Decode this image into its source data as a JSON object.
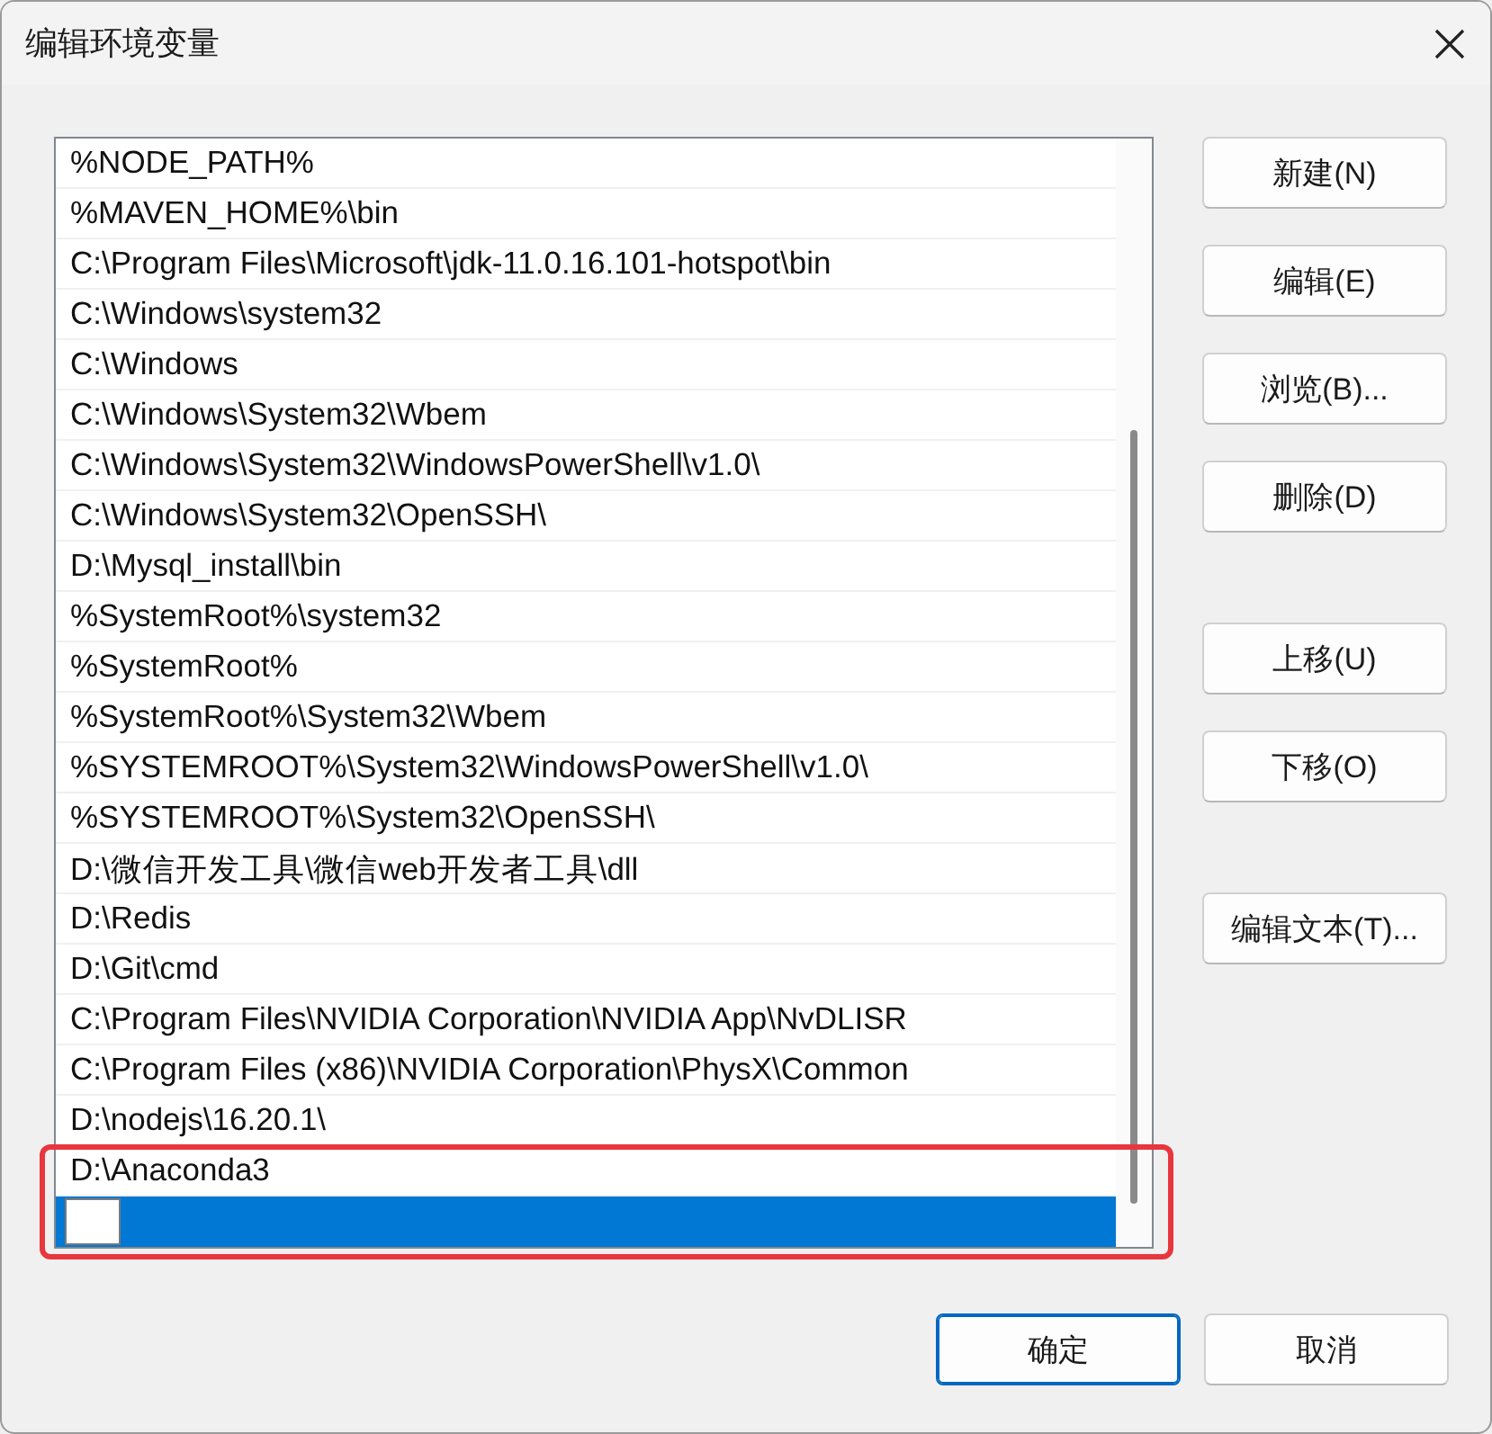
{
  "window": {
    "title": "编辑环境变量"
  },
  "paths": [
    {
      "kind": "text",
      "text": "%NODE_PATH%",
      "selected": false
    },
    {
      "kind": "text",
      "text": "%MAVEN_HOME%\\bin",
      "selected": false
    },
    {
      "kind": "text",
      "text": "C:\\Program Files\\Microsoft\\jdk-11.0.16.101-hotspot\\bin",
      "selected": false
    },
    {
      "kind": "text",
      "text": "C:\\Windows\\system32",
      "selected": false
    },
    {
      "kind": "text",
      "text": "C:\\Windows",
      "selected": false
    },
    {
      "kind": "text",
      "text": "C:\\Windows\\System32\\Wbem",
      "selected": false
    },
    {
      "kind": "text",
      "text": "C:\\Windows\\System32\\WindowsPowerShell\\v1.0\\",
      "selected": false
    },
    {
      "kind": "text",
      "text": "C:\\Windows\\System32\\OpenSSH\\",
      "selected": false
    },
    {
      "kind": "text",
      "text": "D:\\Mysql_install\\bin",
      "selected": false
    },
    {
      "kind": "text",
      "text": "%SystemRoot%\\system32",
      "selected": false
    },
    {
      "kind": "text",
      "text": "%SystemRoot%",
      "selected": false
    },
    {
      "kind": "text",
      "text": "%SystemRoot%\\System32\\Wbem",
      "selected": false
    },
    {
      "kind": "text",
      "text": "%SYSTEMROOT%\\System32\\WindowsPowerShell\\v1.0\\",
      "selected": false
    },
    {
      "kind": "text",
      "text": "%SYSTEMROOT%\\System32\\OpenSSH\\",
      "selected": false
    },
    {
      "kind": "text",
      "text": "D:\\微信开发工具\\微信web开发者工具\\dll",
      "selected": false
    },
    {
      "kind": "text",
      "text": "D:\\Redis",
      "selected": false
    },
    {
      "kind": "text",
      "text": "D:\\Git\\cmd",
      "selected": false
    },
    {
      "kind": "text",
      "text": "C:\\Program Files\\NVIDIA Corporation\\NVIDIA App\\NvDLISR",
      "selected": false
    },
    {
      "kind": "text",
      "text": "C:\\Program Files (x86)\\NVIDIA Corporation\\PhysX\\Common",
      "selected": false
    },
    {
      "kind": "text",
      "text": "D:\\nodejs\\16.20.1\\",
      "selected": false
    },
    {
      "kind": "text",
      "text": "D:\\Anaconda3",
      "selected": false
    },
    {
      "kind": "editing",
      "selected": true
    }
  ],
  "side_button_groups": [
    [
      "新建(N)",
      "编辑(E)",
      "浏览(B)...",
      "删除(D)"
    ],
    [
      "上移(U)",
      "下移(O)"
    ],
    [
      "编辑文本(T)..."
    ]
  ],
  "footer_buttons": [
    {
      "label": "确定",
      "default": true
    },
    {
      "label": "取消",
      "default": false
    }
  ]
}
